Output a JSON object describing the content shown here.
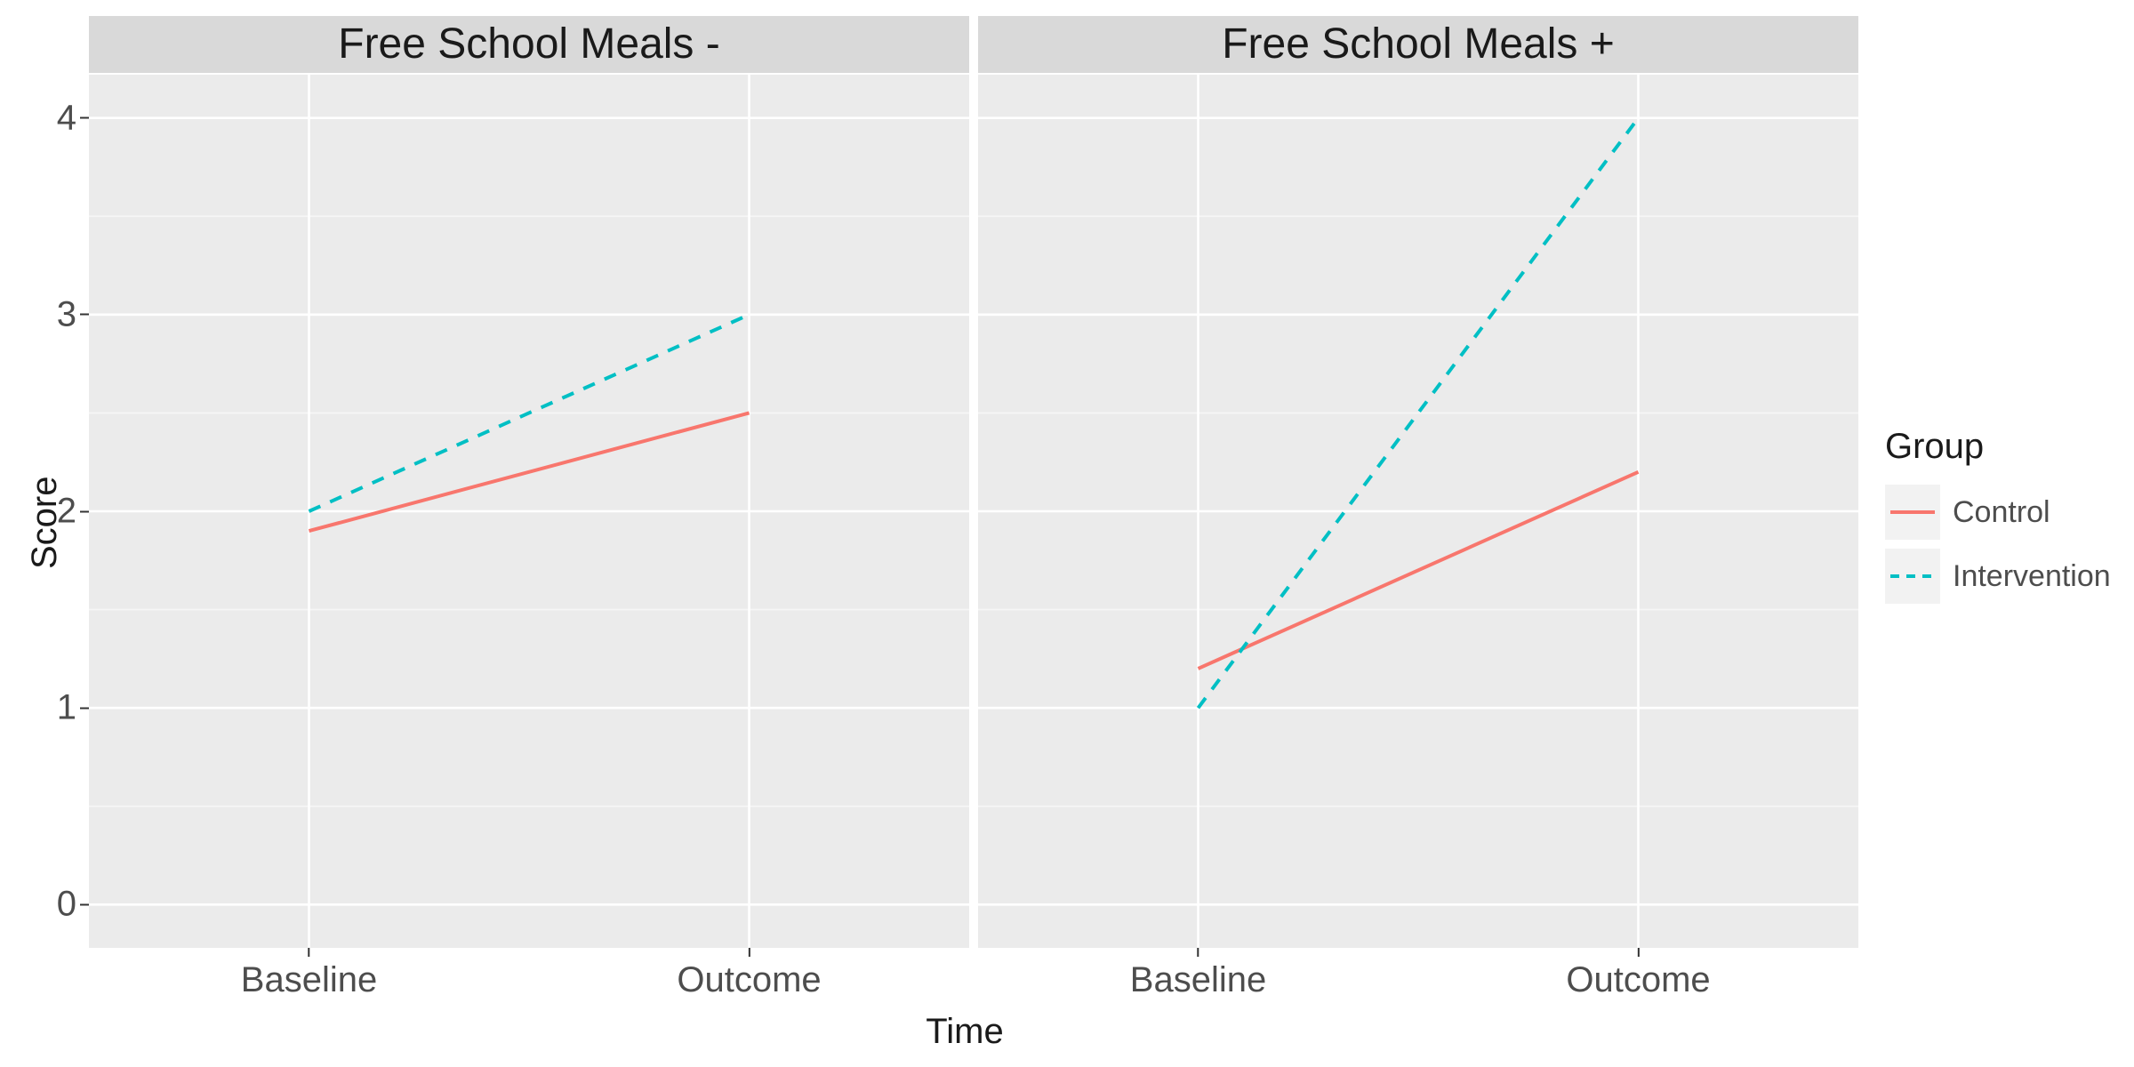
{
  "chart_data": {
    "type": "line",
    "facets": [
      "Free School Meals -",
      "Free School Meals +"
    ],
    "categories": [
      "Baseline",
      "Outcome"
    ],
    "series": [
      {
        "name": "Control",
        "color": "#f8766d",
        "dash": "solid",
        "values_by_facet": [
          [
            1.9,
            2.5
          ],
          [
            1.2,
            2.2
          ]
        ]
      },
      {
        "name": "Intervention",
        "color": "#00bfc4",
        "dash": "dashed",
        "values_by_facet": [
          [
            2.0,
            3.0
          ],
          [
            1.0,
            4.0
          ]
        ]
      }
    ],
    "ylabel": "Score",
    "xlabel": "Time",
    "legend_title": "Group",
    "y_ticks": [
      0,
      1,
      2,
      3,
      4
    ],
    "y_range": [
      -0.22,
      4.22
    ]
  }
}
